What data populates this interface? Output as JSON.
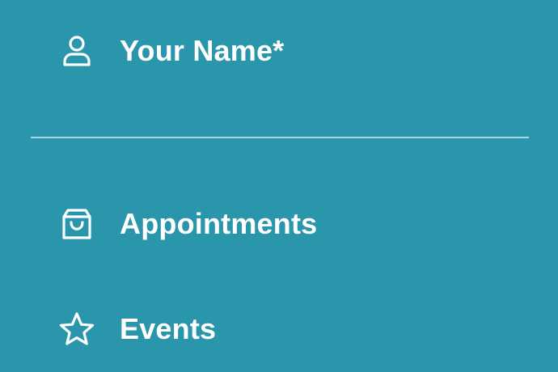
{
  "menu": {
    "items": [
      {
        "label": "Your Name*",
        "icon": "user-icon"
      },
      {
        "label": "Appointments",
        "icon": "shopping-bag-icon"
      },
      {
        "label": "Events",
        "icon": "star-icon"
      }
    ]
  },
  "colors": {
    "background": "#2996ab",
    "text": "#ffffff",
    "divider": "#a8d6df"
  }
}
